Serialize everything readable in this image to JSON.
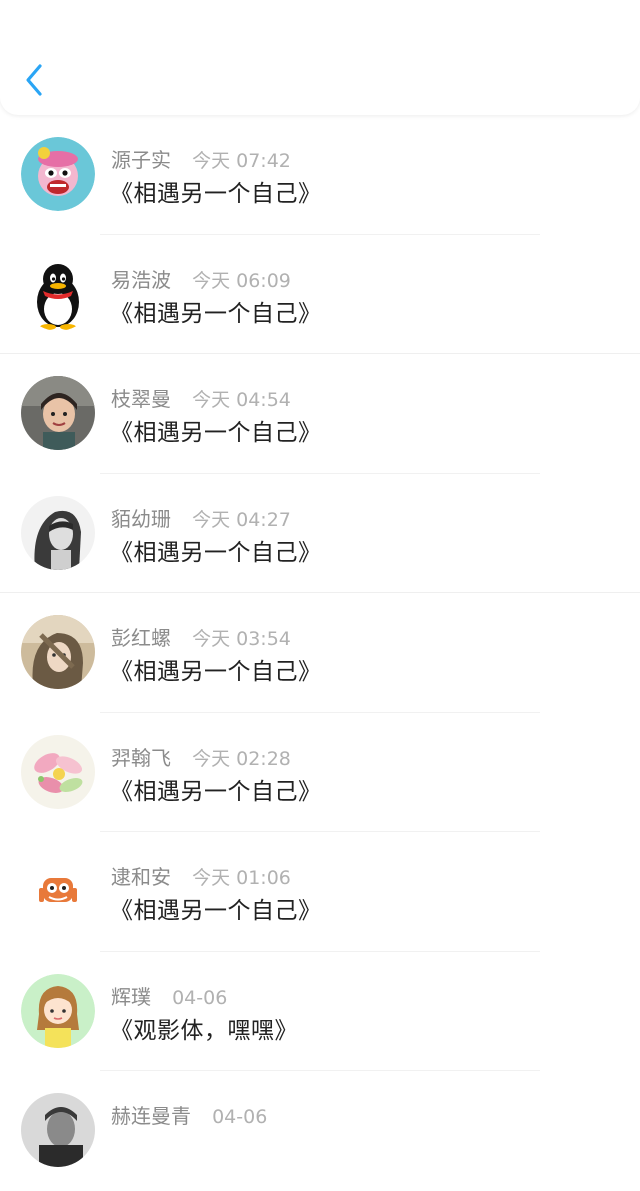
{
  "header": {
    "back_icon": "chevron-left-icon",
    "accent_color": "#2aa5f5"
  },
  "items": [
    {
      "name": "源子实",
      "time": "今天 07:42",
      "title": "《相遇另一个自己》",
      "avatar": "monkey-avatar"
    },
    {
      "name": "易浩波",
      "time": "今天 06:09",
      "title": "《相遇另一个自己》",
      "avatar": "penguin-avatar"
    },
    {
      "name": "枝翠曼",
      "time": "今天 04:54",
      "title": "《相遇另一个自己》",
      "avatar": "child-photo-avatar"
    },
    {
      "name": "貊幼珊",
      "time": "今天 04:27",
      "title": "《相遇另一个自己》",
      "avatar": "woman-photo-avatar"
    },
    {
      "name": "彭红螺",
      "time": "今天 03:54",
      "title": "《相遇另一个自己》",
      "avatar": "girl-photo-avatar"
    },
    {
      "name": "羿翰飞",
      "time": "今天 02:28",
      "title": "《相遇另一个自己》",
      "avatar": "flower-avatar"
    },
    {
      "name": "逮和安",
      "time": "今天 01:06",
      "title": "《相遇另一个自己》",
      "avatar": "cartoon-face-avatar"
    },
    {
      "name": "辉璞",
      "time": "04-06",
      "title": "《观影体，嘿嘿》",
      "avatar": "girl-cartoon-avatar"
    },
    {
      "name": "赫连曼青",
      "time": "04-06",
      "title": "",
      "avatar": "man-photo-avatar"
    }
  ]
}
